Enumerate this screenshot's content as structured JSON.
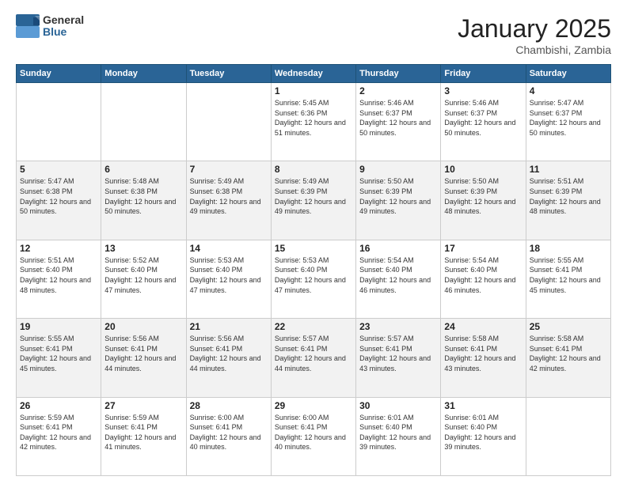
{
  "logo": {
    "general": "General",
    "blue": "Blue"
  },
  "header": {
    "month": "January 2025",
    "location": "Chambishi, Zambia"
  },
  "weekdays": [
    "Sunday",
    "Monday",
    "Tuesday",
    "Wednesday",
    "Thursday",
    "Friday",
    "Saturday"
  ],
  "weeks": [
    [
      {
        "day": "",
        "sunrise": "",
        "sunset": "",
        "daylight": ""
      },
      {
        "day": "",
        "sunrise": "",
        "sunset": "",
        "daylight": ""
      },
      {
        "day": "",
        "sunrise": "",
        "sunset": "",
        "daylight": ""
      },
      {
        "day": "1",
        "sunrise": "Sunrise: 5:45 AM",
        "sunset": "Sunset: 6:36 PM",
        "daylight": "Daylight: 12 hours and 51 minutes."
      },
      {
        "day": "2",
        "sunrise": "Sunrise: 5:46 AM",
        "sunset": "Sunset: 6:37 PM",
        "daylight": "Daylight: 12 hours and 50 minutes."
      },
      {
        "day": "3",
        "sunrise": "Sunrise: 5:46 AM",
        "sunset": "Sunset: 6:37 PM",
        "daylight": "Daylight: 12 hours and 50 minutes."
      },
      {
        "day": "4",
        "sunrise": "Sunrise: 5:47 AM",
        "sunset": "Sunset: 6:37 PM",
        "daylight": "Daylight: 12 hours and 50 minutes."
      }
    ],
    [
      {
        "day": "5",
        "sunrise": "Sunrise: 5:47 AM",
        "sunset": "Sunset: 6:38 PM",
        "daylight": "Daylight: 12 hours and 50 minutes."
      },
      {
        "day": "6",
        "sunrise": "Sunrise: 5:48 AM",
        "sunset": "Sunset: 6:38 PM",
        "daylight": "Daylight: 12 hours and 50 minutes."
      },
      {
        "day": "7",
        "sunrise": "Sunrise: 5:49 AM",
        "sunset": "Sunset: 6:38 PM",
        "daylight": "Daylight: 12 hours and 49 minutes."
      },
      {
        "day": "8",
        "sunrise": "Sunrise: 5:49 AM",
        "sunset": "Sunset: 6:39 PM",
        "daylight": "Daylight: 12 hours and 49 minutes."
      },
      {
        "day": "9",
        "sunrise": "Sunrise: 5:50 AM",
        "sunset": "Sunset: 6:39 PM",
        "daylight": "Daylight: 12 hours and 49 minutes."
      },
      {
        "day": "10",
        "sunrise": "Sunrise: 5:50 AM",
        "sunset": "Sunset: 6:39 PM",
        "daylight": "Daylight: 12 hours and 48 minutes."
      },
      {
        "day": "11",
        "sunrise": "Sunrise: 5:51 AM",
        "sunset": "Sunset: 6:39 PM",
        "daylight": "Daylight: 12 hours and 48 minutes."
      }
    ],
    [
      {
        "day": "12",
        "sunrise": "Sunrise: 5:51 AM",
        "sunset": "Sunset: 6:40 PM",
        "daylight": "Daylight: 12 hours and 48 minutes."
      },
      {
        "day": "13",
        "sunrise": "Sunrise: 5:52 AM",
        "sunset": "Sunset: 6:40 PM",
        "daylight": "Daylight: 12 hours and 47 minutes."
      },
      {
        "day": "14",
        "sunrise": "Sunrise: 5:53 AM",
        "sunset": "Sunset: 6:40 PM",
        "daylight": "Daylight: 12 hours and 47 minutes."
      },
      {
        "day": "15",
        "sunrise": "Sunrise: 5:53 AM",
        "sunset": "Sunset: 6:40 PM",
        "daylight": "Daylight: 12 hours and 47 minutes."
      },
      {
        "day": "16",
        "sunrise": "Sunrise: 5:54 AM",
        "sunset": "Sunset: 6:40 PM",
        "daylight": "Daylight: 12 hours and 46 minutes."
      },
      {
        "day": "17",
        "sunrise": "Sunrise: 5:54 AM",
        "sunset": "Sunset: 6:40 PM",
        "daylight": "Daylight: 12 hours and 46 minutes."
      },
      {
        "day": "18",
        "sunrise": "Sunrise: 5:55 AM",
        "sunset": "Sunset: 6:41 PM",
        "daylight": "Daylight: 12 hours and 45 minutes."
      }
    ],
    [
      {
        "day": "19",
        "sunrise": "Sunrise: 5:55 AM",
        "sunset": "Sunset: 6:41 PM",
        "daylight": "Daylight: 12 hours and 45 minutes."
      },
      {
        "day": "20",
        "sunrise": "Sunrise: 5:56 AM",
        "sunset": "Sunset: 6:41 PM",
        "daylight": "Daylight: 12 hours and 44 minutes."
      },
      {
        "day": "21",
        "sunrise": "Sunrise: 5:56 AM",
        "sunset": "Sunset: 6:41 PM",
        "daylight": "Daylight: 12 hours and 44 minutes."
      },
      {
        "day": "22",
        "sunrise": "Sunrise: 5:57 AM",
        "sunset": "Sunset: 6:41 PM",
        "daylight": "Daylight: 12 hours and 44 minutes."
      },
      {
        "day": "23",
        "sunrise": "Sunrise: 5:57 AM",
        "sunset": "Sunset: 6:41 PM",
        "daylight": "Daylight: 12 hours and 43 minutes."
      },
      {
        "day": "24",
        "sunrise": "Sunrise: 5:58 AM",
        "sunset": "Sunset: 6:41 PM",
        "daylight": "Daylight: 12 hours and 43 minutes."
      },
      {
        "day": "25",
        "sunrise": "Sunrise: 5:58 AM",
        "sunset": "Sunset: 6:41 PM",
        "daylight": "Daylight: 12 hours and 42 minutes."
      }
    ],
    [
      {
        "day": "26",
        "sunrise": "Sunrise: 5:59 AM",
        "sunset": "Sunset: 6:41 PM",
        "daylight": "Daylight: 12 hours and 42 minutes."
      },
      {
        "day": "27",
        "sunrise": "Sunrise: 5:59 AM",
        "sunset": "Sunset: 6:41 PM",
        "daylight": "Daylight: 12 hours and 41 minutes."
      },
      {
        "day": "28",
        "sunrise": "Sunrise: 6:00 AM",
        "sunset": "Sunset: 6:41 PM",
        "daylight": "Daylight: 12 hours and 40 minutes."
      },
      {
        "day": "29",
        "sunrise": "Sunrise: 6:00 AM",
        "sunset": "Sunset: 6:41 PM",
        "daylight": "Daylight: 12 hours and 40 minutes."
      },
      {
        "day": "30",
        "sunrise": "Sunrise: 6:01 AM",
        "sunset": "Sunset: 6:40 PM",
        "daylight": "Daylight: 12 hours and 39 minutes."
      },
      {
        "day": "31",
        "sunrise": "Sunrise: 6:01 AM",
        "sunset": "Sunset: 6:40 PM",
        "daylight": "Daylight: 12 hours and 39 minutes."
      },
      {
        "day": "",
        "sunrise": "",
        "sunset": "",
        "daylight": ""
      }
    ]
  ]
}
